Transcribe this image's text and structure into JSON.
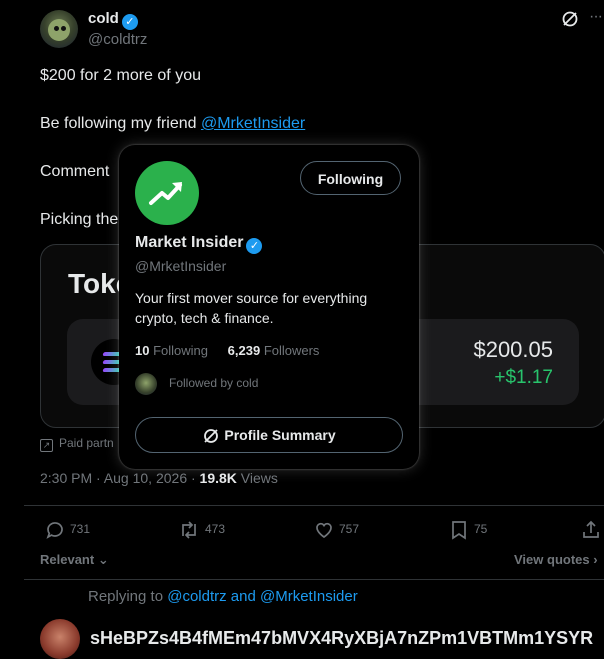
{
  "tweet": {
    "author_name": "cold",
    "author_handle": "@coldtrz",
    "lines": {
      "line1": "$200 for 2 more of you",
      "line2_prefix": "Be following my friend ",
      "line2_mention": "@MrketInsider",
      "line3": "Comment",
      "line4": "Picking the"
    },
    "card": {
      "title": "Toke",
      "amount": "$200.05",
      "change": "+$1.17",
      "paid_label": "Paid partn"
    },
    "time": "2:30 PM · Aug 10, 2026 · ",
    "views_count": "19.8K",
    "views_label": " Views",
    "actions": {
      "replies": "731",
      "reposts": "473",
      "likes": "757",
      "bookmarks": "75"
    },
    "sort_label": "Relevant",
    "view_quotes": "View quotes"
  },
  "reply": {
    "replying_prefix": "Replying to ",
    "replying_to": "@coldtrz and @MrketInsider",
    "text": "sHeBPZs4B4fMEm47bMVX4RyXBjA7nZPm1VBTMm1YSYR"
  },
  "popover": {
    "name": "Market Insider",
    "handle": "@MrketInsider",
    "bio": "Your first mover source for everything crypto, tech & finance.",
    "following_count": "10",
    "following_label": "Following",
    "followers_count": "6,239",
    "followers_label": "Followers",
    "followed_by": "Followed by cold",
    "follow_button": "Following",
    "profile_button": "Profile Summary"
  },
  "colors": {
    "accent": "#1d9bf0",
    "positive": "#28c46c",
    "logo_green": "#2bb14c"
  },
  "icons": [
    "verified-badge-icon",
    "grok-icon",
    "more-icon",
    "reply-icon",
    "repost-icon",
    "like-icon",
    "bookmark-icon",
    "share-icon",
    "chevron-down-icon",
    "chevron-right-icon",
    "paid-partnership-icon",
    "chart-trend-icon"
  ]
}
